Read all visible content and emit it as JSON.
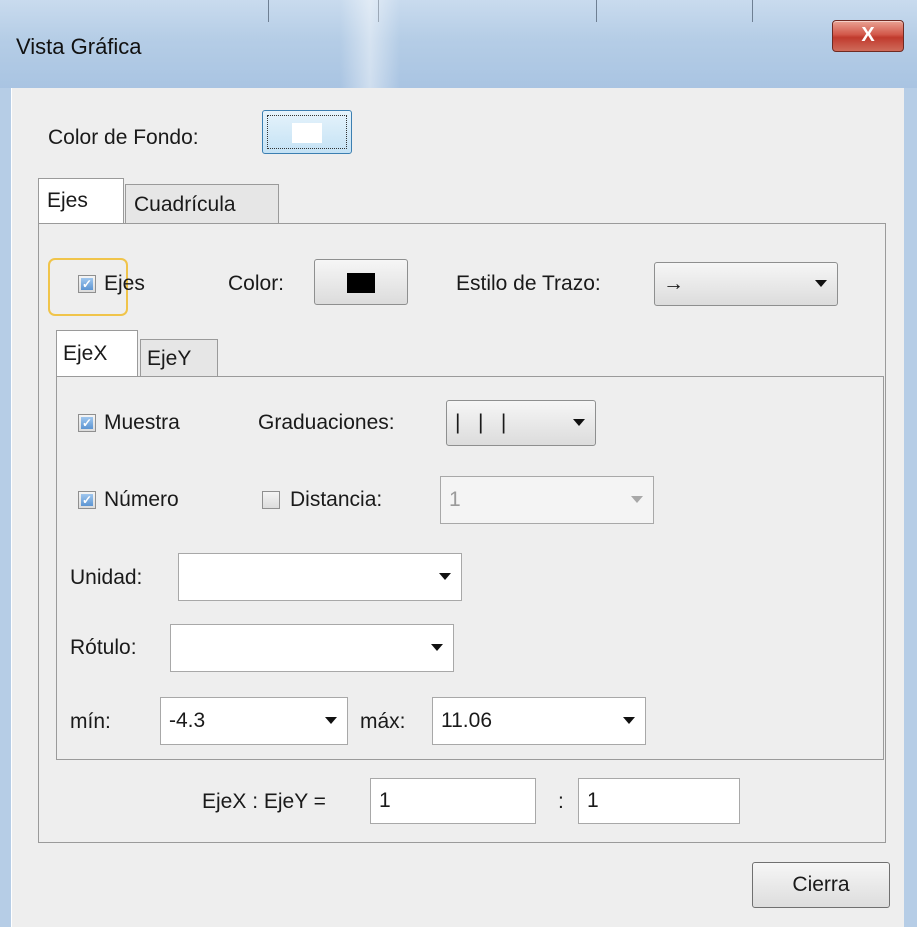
{
  "window": {
    "title": "Vista Gráfica",
    "close_label": "X"
  },
  "background": {
    "label": "Color de Fondo:",
    "color": "#ffffff"
  },
  "outer_tabs": [
    {
      "label": "Ejes",
      "active": true
    },
    {
      "label": "Cuadrícula",
      "active": false
    }
  ],
  "axes": {
    "show_label": "Ejes",
    "show_checked": true,
    "color_label": "Color:",
    "color": "#000000",
    "line_style_label": "Estilo de Trazo:",
    "line_style_value": "→"
  },
  "inner_tabs": [
    {
      "label": "EjeX",
      "active": true
    },
    {
      "label": "EjeY",
      "active": false
    }
  ],
  "ejex": {
    "muestra_label": "Muestra",
    "muestra_checked": true,
    "graduaciones_label": "Graduaciones:",
    "graduaciones_value": "|   |   |",
    "numero_label": "Número",
    "numero_checked": true,
    "distancia_label": "Distancia:",
    "distancia_checked": false,
    "distancia_value": "1",
    "unidad_label": "Unidad:",
    "unidad_value": "",
    "rotulo_label": "Rótulo:",
    "rotulo_value": "",
    "min_label": "mín:",
    "min_value": "-4.3",
    "max_label": "máx:",
    "max_value": "11.06"
  },
  "ratio": {
    "label": "EjeX : EjeY =",
    "x_value": "1",
    "separator": ":",
    "y_value": "1"
  },
  "footer": {
    "close_button": "Cierra"
  }
}
